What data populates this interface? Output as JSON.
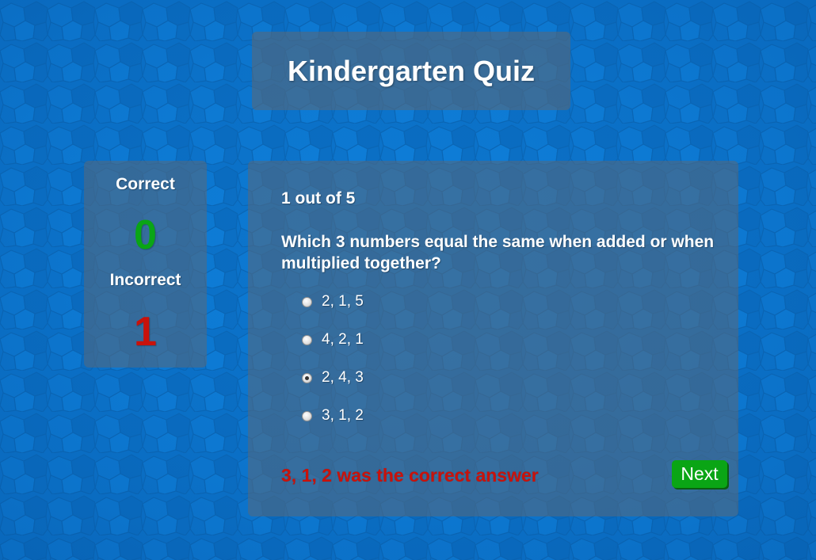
{
  "header": {
    "title": "Kindergarten Quiz"
  },
  "score": {
    "correct_label": "Correct",
    "correct_value": "0",
    "incorrect_label": "Incorrect",
    "incorrect_value": "1"
  },
  "quiz": {
    "progress": "1 out of 5",
    "question": "Which 3 numbers equal the same when added or when multiplied together?",
    "options": [
      {
        "label": "2, 1, 5",
        "selected": false
      },
      {
        "label": "4, 2, 1",
        "selected": false
      },
      {
        "label": "2, 4, 3",
        "selected": true
      },
      {
        "label": "3, 1, 2",
        "selected": false
      }
    ],
    "feedback": "3, 1, 2 was the correct answer",
    "next_label": "Next"
  },
  "colors": {
    "background": "#0b72c9",
    "panel": "#55697d",
    "correct": "#0aa515",
    "incorrect": "#c8120b",
    "next_button": "#0aa515"
  },
  "icons": {
    "radio": "radio-button-icon"
  }
}
